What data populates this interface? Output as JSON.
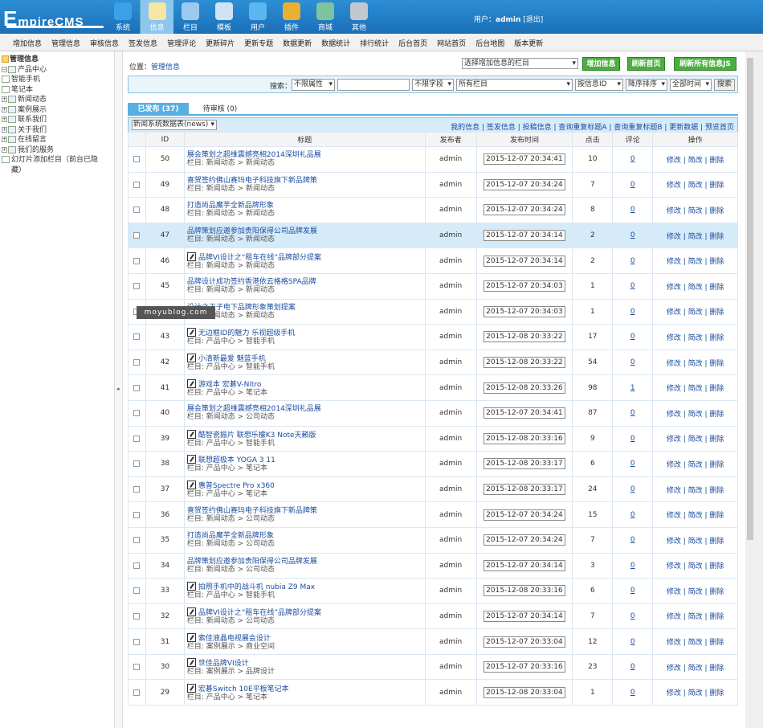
{
  "header": {
    "logo_big": "E",
    "logo_rest": "mpireCMS",
    "nav": [
      {
        "label": "系统",
        "icon": "globe-icon",
        "active": false
      },
      {
        "label": "信息",
        "icon": "notepad-icon",
        "active": true
      },
      {
        "label": "栏目",
        "icon": "folder-icon",
        "active": false
      },
      {
        "label": "模板",
        "icon": "window-icon",
        "active": false
      },
      {
        "label": "用户",
        "icon": "user-icon",
        "active": false
      },
      {
        "label": "插件",
        "icon": "tools-icon",
        "active": false
      },
      {
        "label": "商城",
        "icon": "shop-icon",
        "active": false
      },
      {
        "label": "其他",
        "icon": "gear-icon",
        "active": false
      }
    ],
    "user_prefix": "用户：",
    "user_name": "admin",
    "logout": "[退出]"
  },
  "subnav": [
    "增加信息",
    "管理信息",
    "审核信息",
    "签发信息",
    "管理评论",
    "更新碎片",
    "更新专题",
    "数据更新",
    "数据统计",
    "排行统计",
    "后台首页",
    "网站首页",
    "后台地图",
    "版本更新"
  ],
  "sidebar": {
    "title": "管理信息",
    "items": [
      {
        "label": "产品中心",
        "level": 1,
        "expanded": true
      },
      {
        "label": "智能手机",
        "level": 2
      },
      {
        "label": "笔记本",
        "level": 2
      },
      {
        "label": "新闻动态",
        "level": 1
      },
      {
        "label": "案例展示",
        "level": 1
      },
      {
        "label": "联系我们",
        "level": 1
      },
      {
        "label": "关于我们",
        "level": 1
      },
      {
        "label": "在线留言",
        "level": 1
      },
      {
        "label": "我们的服务",
        "level": 1
      },
      {
        "label": "幻灯片添加栏目（前台已隐藏）",
        "level": 3
      }
    ]
  },
  "main": {
    "location_label": "位置：",
    "location_link": "管理信息",
    "column_select": "选择增加信息的栏目",
    "buttons": {
      "add": "增加信息",
      "refresh_home": "刷新首页",
      "refresh_js": "刷新所有信息JS"
    },
    "search": {
      "label": "搜索：",
      "attr": "不限属性",
      "field": "不限字段",
      "column": "所有栏目",
      "order_by": "按信息ID",
      "order": "降序排序",
      "time": "全部时间",
      "button": "搜索"
    },
    "tabs": [
      {
        "label": "已发布 (37)",
        "active": true
      },
      {
        "label": "待审核 (0)",
        "active": false
      }
    ],
    "table_select": "新闻系统数据表(news)",
    "links": "我的信息 | 签发信息 | 投稿信息 | 查询重复标题A | 查询重复标题B | 更新数据 | 预览首页",
    "columns": [
      "ID",
      "标题",
      "发布者",
      "发布时间",
      "点击",
      "评论",
      "操作"
    ],
    "ops": "修改 | 简改 | 删除",
    "rows": [
      {
        "id": "50",
        "title": "展会策划之超维震撼亮相2014深圳礼品展",
        "cat": "栏目: 新闻动态 > 新闻动态",
        "user": "admin",
        "time": "2015-12-07 20:34:41",
        "hits": "10",
        "comments": "0",
        "icon": false,
        "hl": false
      },
      {
        "id": "49",
        "title": "喜贺签约佛山赛玛电子科技旗下新品牌策",
        "cat": "栏目: 新闻动态 > 新闻动态",
        "user": "admin",
        "time": "2015-12-07 20:34:24",
        "hits": "7",
        "comments": "0",
        "icon": false,
        "hl": false
      },
      {
        "id": "48",
        "title": "打造尚品魔芋全新品牌形象",
        "cat": "栏目: 新闻动态 > 新闻动态",
        "user": "admin",
        "time": "2015-12-07 20:34:24",
        "hits": "8",
        "comments": "0",
        "icon": false,
        "hl": false
      },
      {
        "id": "47",
        "title": "品牌策划应邀参加贵阳保得公司品牌发展",
        "cat": "栏目: 新闻动态 > 新闻动态",
        "user": "admin",
        "time": "2015-12-07 20:34:14",
        "hits": "2",
        "comments": "0",
        "icon": false,
        "hl": true
      },
      {
        "id": "46",
        "title": "品牌VI设计之“租车在线”品牌部分提案",
        "cat": "栏目: 新闻动态 > 新闻动态",
        "user": "admin",
        "time": "2015-12-07 20:34:14",
        "hits": "2",
        "comments": "0",
        "icon": true,
        "hl": false
      },
      {
        "id": "45",
        "title": "品牌设计成功签约香港依云格格SPA品牌",
        "cat": "栏目: 新闻动态 > 新闻动态",
        "user": "admin",
        "time": "2015-12-07 20:34:03",
        "hits": "1",
        "comments": "0",
        "icon": false,
        "hl": false
      },
      {
        "id": "44",
        "title": "设计之王子电下品牌形象策划提案",
        "cat": "栏目: 新闻动态 > 新闻动态",
        "user": "admin",
        "time": "2015-12-07 20:34:03",
        "hits": "1",
        "comments": "0",
        "icon": false,
        "hl": false
      },
      {
        "id": "43",
        "title": "无边框ID的魅力 乐视超级手机",
        "cat": "栏目: 产品中心 > 智能手机",
        "user": "admin",
        "time": "2015-12-08 20:33:22",
        "hits": "17",
        "comments": "0",
        "icon": true,
        "hl": false
      },
      {
        "id": "42",
        "title": "小清新最爱 魅蓝手机",
        "cat": "栏目: 产品中心 > 智能手机",
        "user": "admin",
        "time": "2015-12-08 20:33:22",
        "hits": "54",
        "comments": "0",
        "icon": true,
        "hl": false
      },
      {
        "id": "41",
        "title": "游戏本 宏碁V-Nitro",
        "cat": "栏目: 产品中心 > 笔记本",
        "user": "admin",
        "time": "2015-12-08 20:33:26",
        "hits": "98",
        "comments": "1",
        "icon": true,
        "hl": false
      },
      {
        "id": "40",
        "title": "展会策划之超维震撼亮相2014深圳礼品展",
        "cat": "栏目: 新闻动态 > 公司动态",
        "user": "admin",
        "time": "2015-12-07 20:34:41",
        "hits": "87",
        "comments": "0",
        "icon": false,
        "hl": false
      },
      {
        "id": "39",
        "title": "酷智瓷振片 联想乐檬K3 Note天籁版",
        "cat": "栏目: 产品中心 > 智能手机",
        "user": "admin",
        "time": "2015-12-08 20:33:16",
        "hits": "9",
        "comments": "0",
        "icon": true,
        "hl": false
      },
      {
        "id": "38",
        "title": "联想超极本 YOGA 3 11",
        "cat": "栏目: 产品中心 > 笔记本",
        "user": "admin",
        "time": "2015-12-08 20:33:17",
        "hits": "6",
        "comments": "0",
        "icon": true,
        "hl": false
      },
      {
        "id": "37",
        "title": "惠普Spectre Pro x360",
        "cat": "栏目: 产品中心 > 笔记本",
        "user": "admin",
        "time": "2015-12-08 20:33:17",
        "hits": "24",
        "comments": "0",
        "icon": true,
        "hl": false
      },
      {
        "id": "36",
        "title": "喜贺签约佛山赛玛电子科技旗下新品牌策",
        "cat": "栏目: 新闻动态 > 公司动态",
        "user": "admin",
        "time": "2015-12-07 20:34:24",
        "hits": "15",
        "comments": "0",
        "icon": false,
        "hl": false
      },
      {
        "id": "35",
        "title": "打造尚品魔芋全新品牌形象",
        "cat": "栏目: 新闻动态 > 公司动态",
        "user": "admin",
        "time": "2015-12-07 20:34:24",
        "hits": "7",
        "comments": "0",
        "icon": false,
        "hl": false
      },
      {
        "id": "34",
        "title": "品牌策划应邀参加贵阳保得公司品牌发展",
        "cat": "栏目: 新闻动态 > 公司动态",
        "user": "admin",
        "time": "2015-12-07 20:34:14",
        "hits": "3",
        "comments": "0",
        "icon": false,
        "hl": false
      },
      {
        "id": "33",
        "title": "拍照手机中的战斗机 nubia Z9 Max",
        "cat": "栏目: 产品中心 > 智能手机",
        "user": "admin",
        "time": "2015-12-08 20:33:16",
        "hits": "6",
        "comments": "0",
        "icon": true,
        "hl": false
      },
      {
        "id": "32",
        "title": "品牌VI设计之“租车在线”品牌部分提案",
        "cat": "栏目: 新闻动态 > 公司动态",
        "user": "admin",
        "time": "2015-12-07 20:34:14",
        "hits": "7",
        "comments": "0",
        "icon": true,
        "hl": false
      },
      {
        "id": "31",
        "title": "索佳液晶电视展会设计",
        "cat": "栏目: 案例展示 > 商业空间",
        "user": "admin",
        "time": "2015-12-07 20:33:04",
        "hits": "12",
        "comments": "0",
        "icon": true,
        "hl": false
      },
      {
        "id": "30",
        "title": "世佳品牌VI设计",
        "cat": "栏目: 案例展示 > 品牌设计",
        "user": "admin",
        "time": "2015-12-07 20:33:16",
        "hits": "23",
        "comments": "0",
        "icon": true,
        "hl": false
      },
      {
        "id": "29",
        "title": "宏碁Switch 10E平板笔记本",
        "cat": "栏目: 产品中心 > 笔记本",
        "user": "admin",
        "time": "2015-12-08 20:33:04",
        "hits": "1",
        "comments": "0",
        "icon": true,
        "hl": false
      }
    ]
  },
  "watermark": "moyublog.com",
  "colors": {
    "topbar": "#1a6fb8",
    "accent": "#5aafe2",
    "button_green": "#4cae3f",
    "link": "#1a4c9e",
    "highlight_row": "#d6ebfa"
  }
}
